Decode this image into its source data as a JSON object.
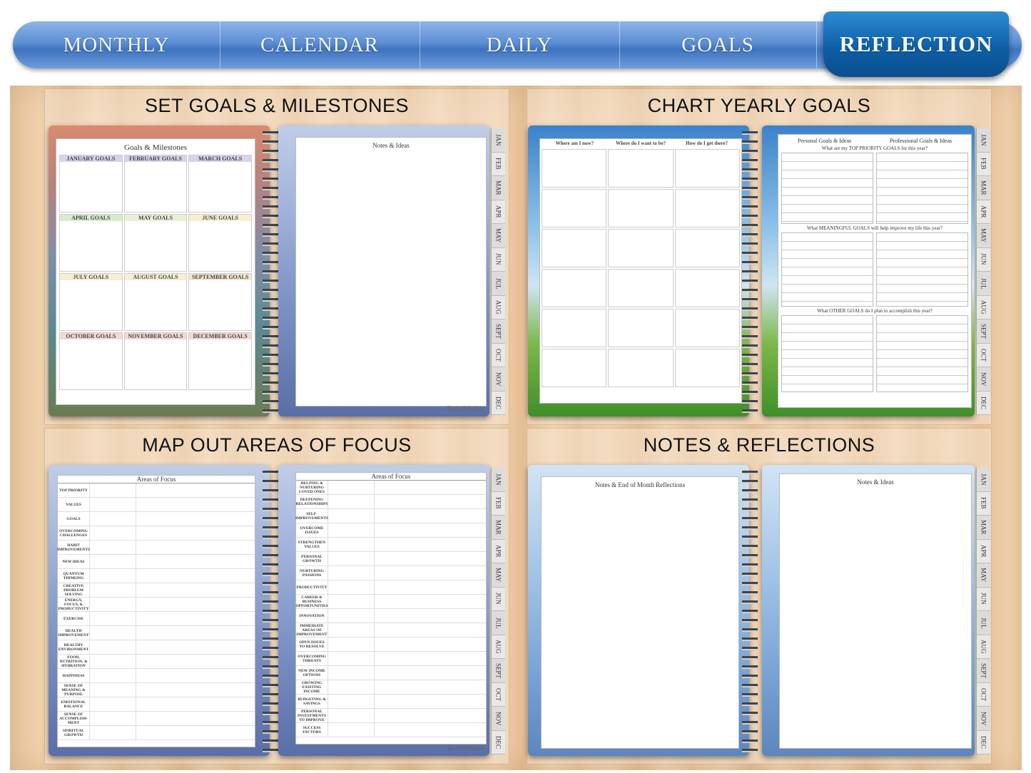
{
  "nav": {
    "tabs": [
      {
        "label": "MONTHLY"
      },
      {
        "label": "CALENDAR"
      },
      {
        "label": "DAILY"
      },
      {
        "label": "GOALS"
      },
      {
        "label": "REFLECTION"
      }
    ],
    "active": "REFLECTION"
  },
  "panels": {
    "p1": {
      "title": "SET GOALS & MILESTONES"
    },
    "p2": {
      "title": "CHART YEARLY GOALS"
    },
    "p3": {
      "title": "MAP OUT AREAS OF FOCUS"
    },
    "p4": {
      "title": "NOTES & REFLECTIONS"
    }
  },
  "month_tabs": [
    "JAN",
    "FEB",
    "MAR",
    "APR",
    "MAY",
    "JUN",
    "JUL",
    "AUG",
    "SEPT",
    "OCT",
    "NOV",
    "DEC"
  ],
  "goals_page": {
    "title": "Goals & Milestones",
    "months": [
      "JANUARY GOALS",
      "FEBRUARY GOALS",
      "MARCH GOALS",
      "APRIL GOALS",
      "MAY GOALS",
      "JUNE GOALS",
      "JULY GOALS",
      "AUGUST GOALS",
      "SEPTEMBER GOALS",
      "OCTOBER GOALS",
      "NOVEMBER GOALS",
      "DECEMBER GOALS"
    ],
    "notes_title": "Notes & Ideas"
  },
  "yearly_page": {
    "col1": "Where am I now?",
    "col2": "Where do I want to be?",
    "col3": "How do I get there?",
    "personal": "Personal Goals & Ideas",
    "professional": "Professional Goals & Ideas",
    "q1": "What are my TOP PRIORITY GOALS for this year?",
    "q2": "What MEANINGFUL GOALS will help improve my life this year?",
    "q3": "What OTHER GOALS do I plan to accomplish this year?"
  },
  "focus_page": {
    "title": "Areas of Focus",
    "left_rows": [
      "TOP PRIORITY",
      "VALUES",
      "GOALS",
      "OVERCOMING CHALLENGES",
      "HABIT IMPROVEMENTS",
      "NEW IDEAS",
      "QUANTUM THINKING",
      "CREATIVE PROBLEM SOLVING",
      "ENERGY, FOCUS, & PRODUCTIVITY",
      "EXERCISE",
      "HEALTH IMPROVEMENT",
      "HEALTHY ENVIRONMENT",
      "FOOD, NUTRITION, & HYDRATION",
      "HAPPINESS",
      "SENSE OF MEANING & PURPOSE",
      "EMOTIONAL BALANCE",
      "SENSE OF ACCOMPLISH-MENT",
      "SPIRITUAL GROWTH"
    ],
    "right_rows": [
      "HELPING & NURTURING LOVED ONES",
      "DEEPENING RELATIONSHIPS",
      "SELF-IMPROVEMENTS",
      "OVERCOME ISSUES",
      "STRENGTHEN VALUES",
      "PERSONAL GROWTH",
      "NURTURING PASSIONS",
      "PRODUCTIVITY",
      "CAREER & BUSINESS OPPORTUNITIES",
      "INNOVATION",
      "IMMEDIATE AREAS OF IMPROVEMENT",
      "OPEN ISSUES TO RESOLVE",
      "OVERCOMING THREATS",
      "NEW INCOME OPTIONS",
      "GROWING EXISTING INCOME",
      "BUDGETING & SAVINGS",
      "PERSONAL INVESTMENTS TO IMPROVE",
      "SUCCESS FACTORS"
    ]
  },
  "reflect_page": {
    "left_title": "Notes & End of Month Reflections",
    "right_title": "Notes & Ideas"
  },
  "brand": "Tools4Wisdom"
}
